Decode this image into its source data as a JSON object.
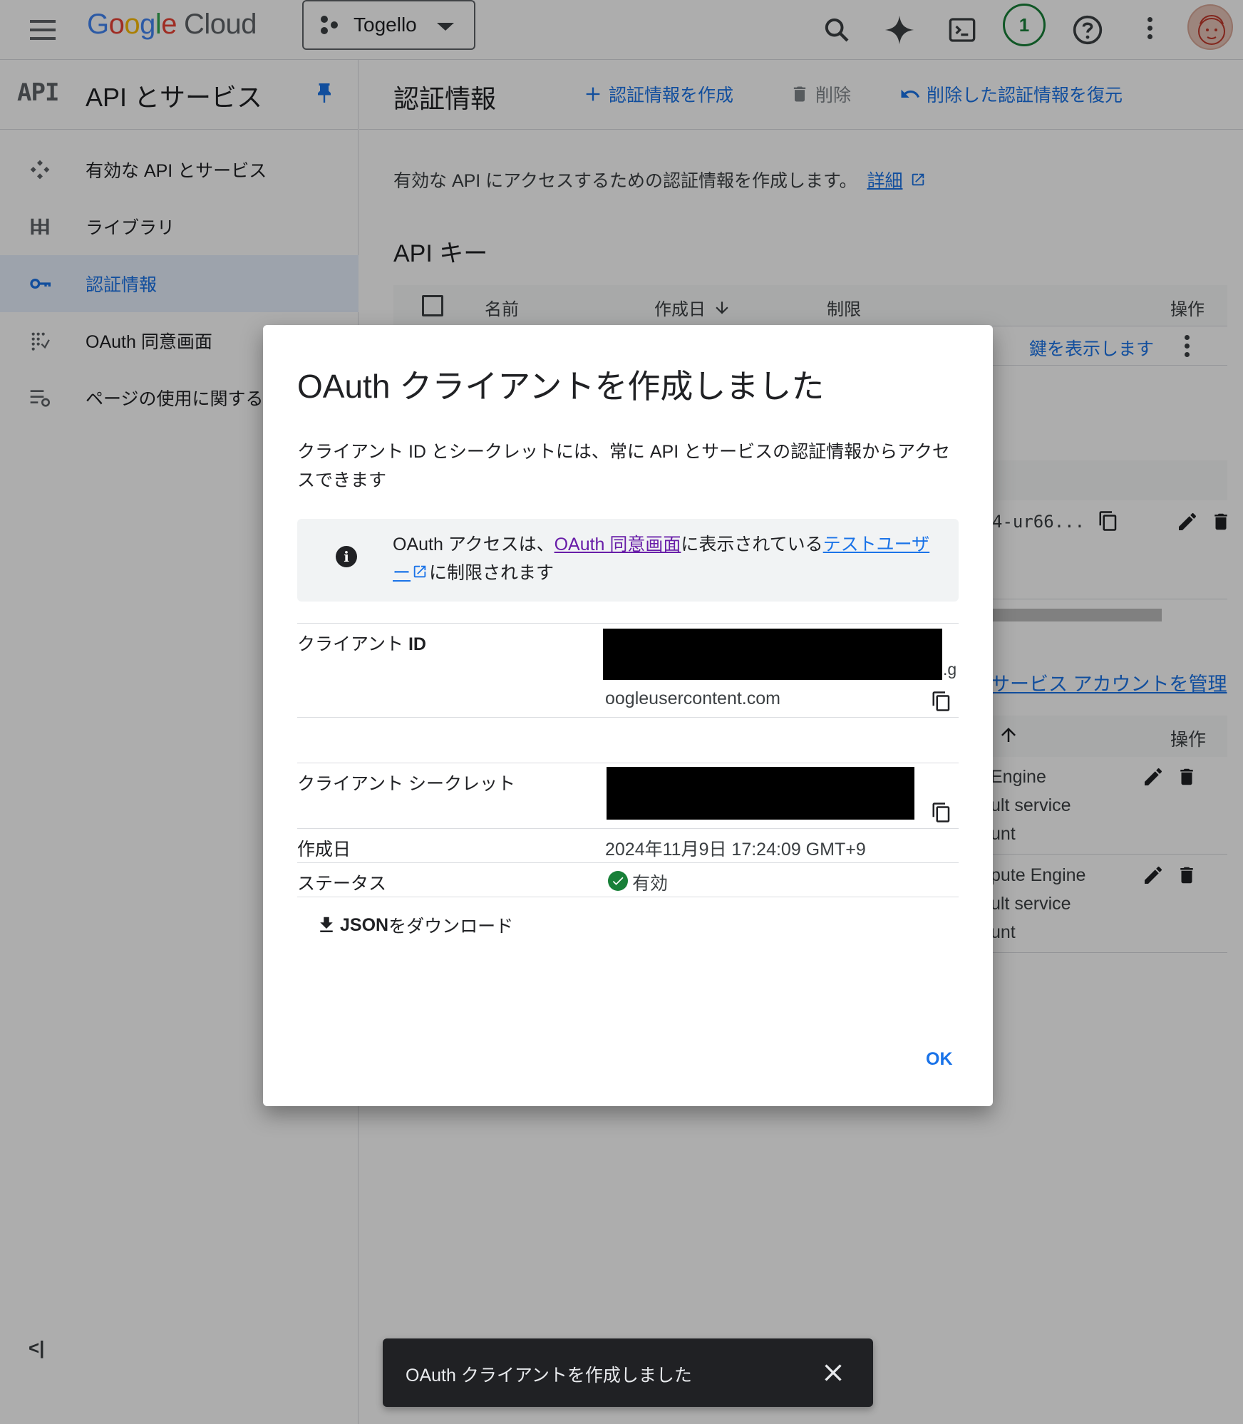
{
  "topbar": {
    "logo_google": [
      "G",
      "o",
      "o",
      "g",
      "l",
      "e"
    ],
    "logo_cloud": "Cloud",
    "project_name": "Togello",
    "notification_count": "1"
  },
  "sidebar": {
    "api_badge": "API",
    "title": "API とサービス",
    "items": [
      {
        "label": "有効な API とサービス",
        "icon": "api-services-icon"
      },
      {
        "label": "ライブラリ",
        "icon": "library-icon"
      },
      {
        "label": "認証情報",
        "icon": "key-icon"
      },
      {
        "label": "OAuth 同意画面",
        "icon": "oauth-consent-icon"
      },
      {
        "label": "ページの使用に関する",
        "icon": "page-usage-icon"
      }
    ],
    "collapse_label": "<|"
  },
  "main": {
    "title": "認証情報",
    "actions": {
      "create": "認証情報を作成",
      "delete": "削除",
      "restore": "削除した認証情報を復元"
    },
    "description": "有効な API にアクセスするための認証情報を作成します。",
    "details_link": "詳細",
    "api_keys_title": "API キー",
    "table_headers": {
      "name": "名前",
      "created": "作成日",
      "restriction": "制限",
      "actions": "操作"
    },
    "show_key_link": "鍵を表示します",
    "client_id_fragment": "4-ur66...",
    "manage_service_accounts": "サービス アカウントを管理",
    "sa_actions_header": "操作",
    "service_account_rows": [
      {
        "line1": "Engine",
        "line2": "ult service",
        "line3": "unt"
      },
      {
        "line1": "pute Engine",
        "line2": "ult service",
        "line3": "unt"
      }
    ]
  },
  "dialog": {
    "title": "OAuth クライアントを作成しました",
    "description": "クライアント ID とシークレットには、常に API とサービスの認証情報からアクセスできます",
    "info": {
      "prefix": "OAuth アクセスは、",
      "consent_link": "OAuth 同意画面",
      "middle": "に表示されている",
      "test_users_link": "テストユーザー",
      "suffix": "に制限されます"
    },
    "client_id_label": "クライアント ",
    "client_id_label_bold": "ID",
    "client_id_tail": ".g",
    "client_id_domain": "oogleusercontent.com",
    "client_secret_label": "クライアント シークレット",
    "created_label": "作成日",
    "created_value": "2024年11月9日 17:24:09 GMT+9",
    "status_label": "ステータス",
    "status_value": "有効",
    "download_bold": "JSON",
    "download_rest": " をダウンロード",
    "ok_label": "OK"
  },
  "snackbar": {
    "message": "OAuth クライアントを作成しました"
  },
  "colors": {
    "accent": "#1a73e8",
    "success": "#188038",
    "visited_link": "#681da8",
    "scrim": "rgba(0,0,0,0.32)"
  }
}
